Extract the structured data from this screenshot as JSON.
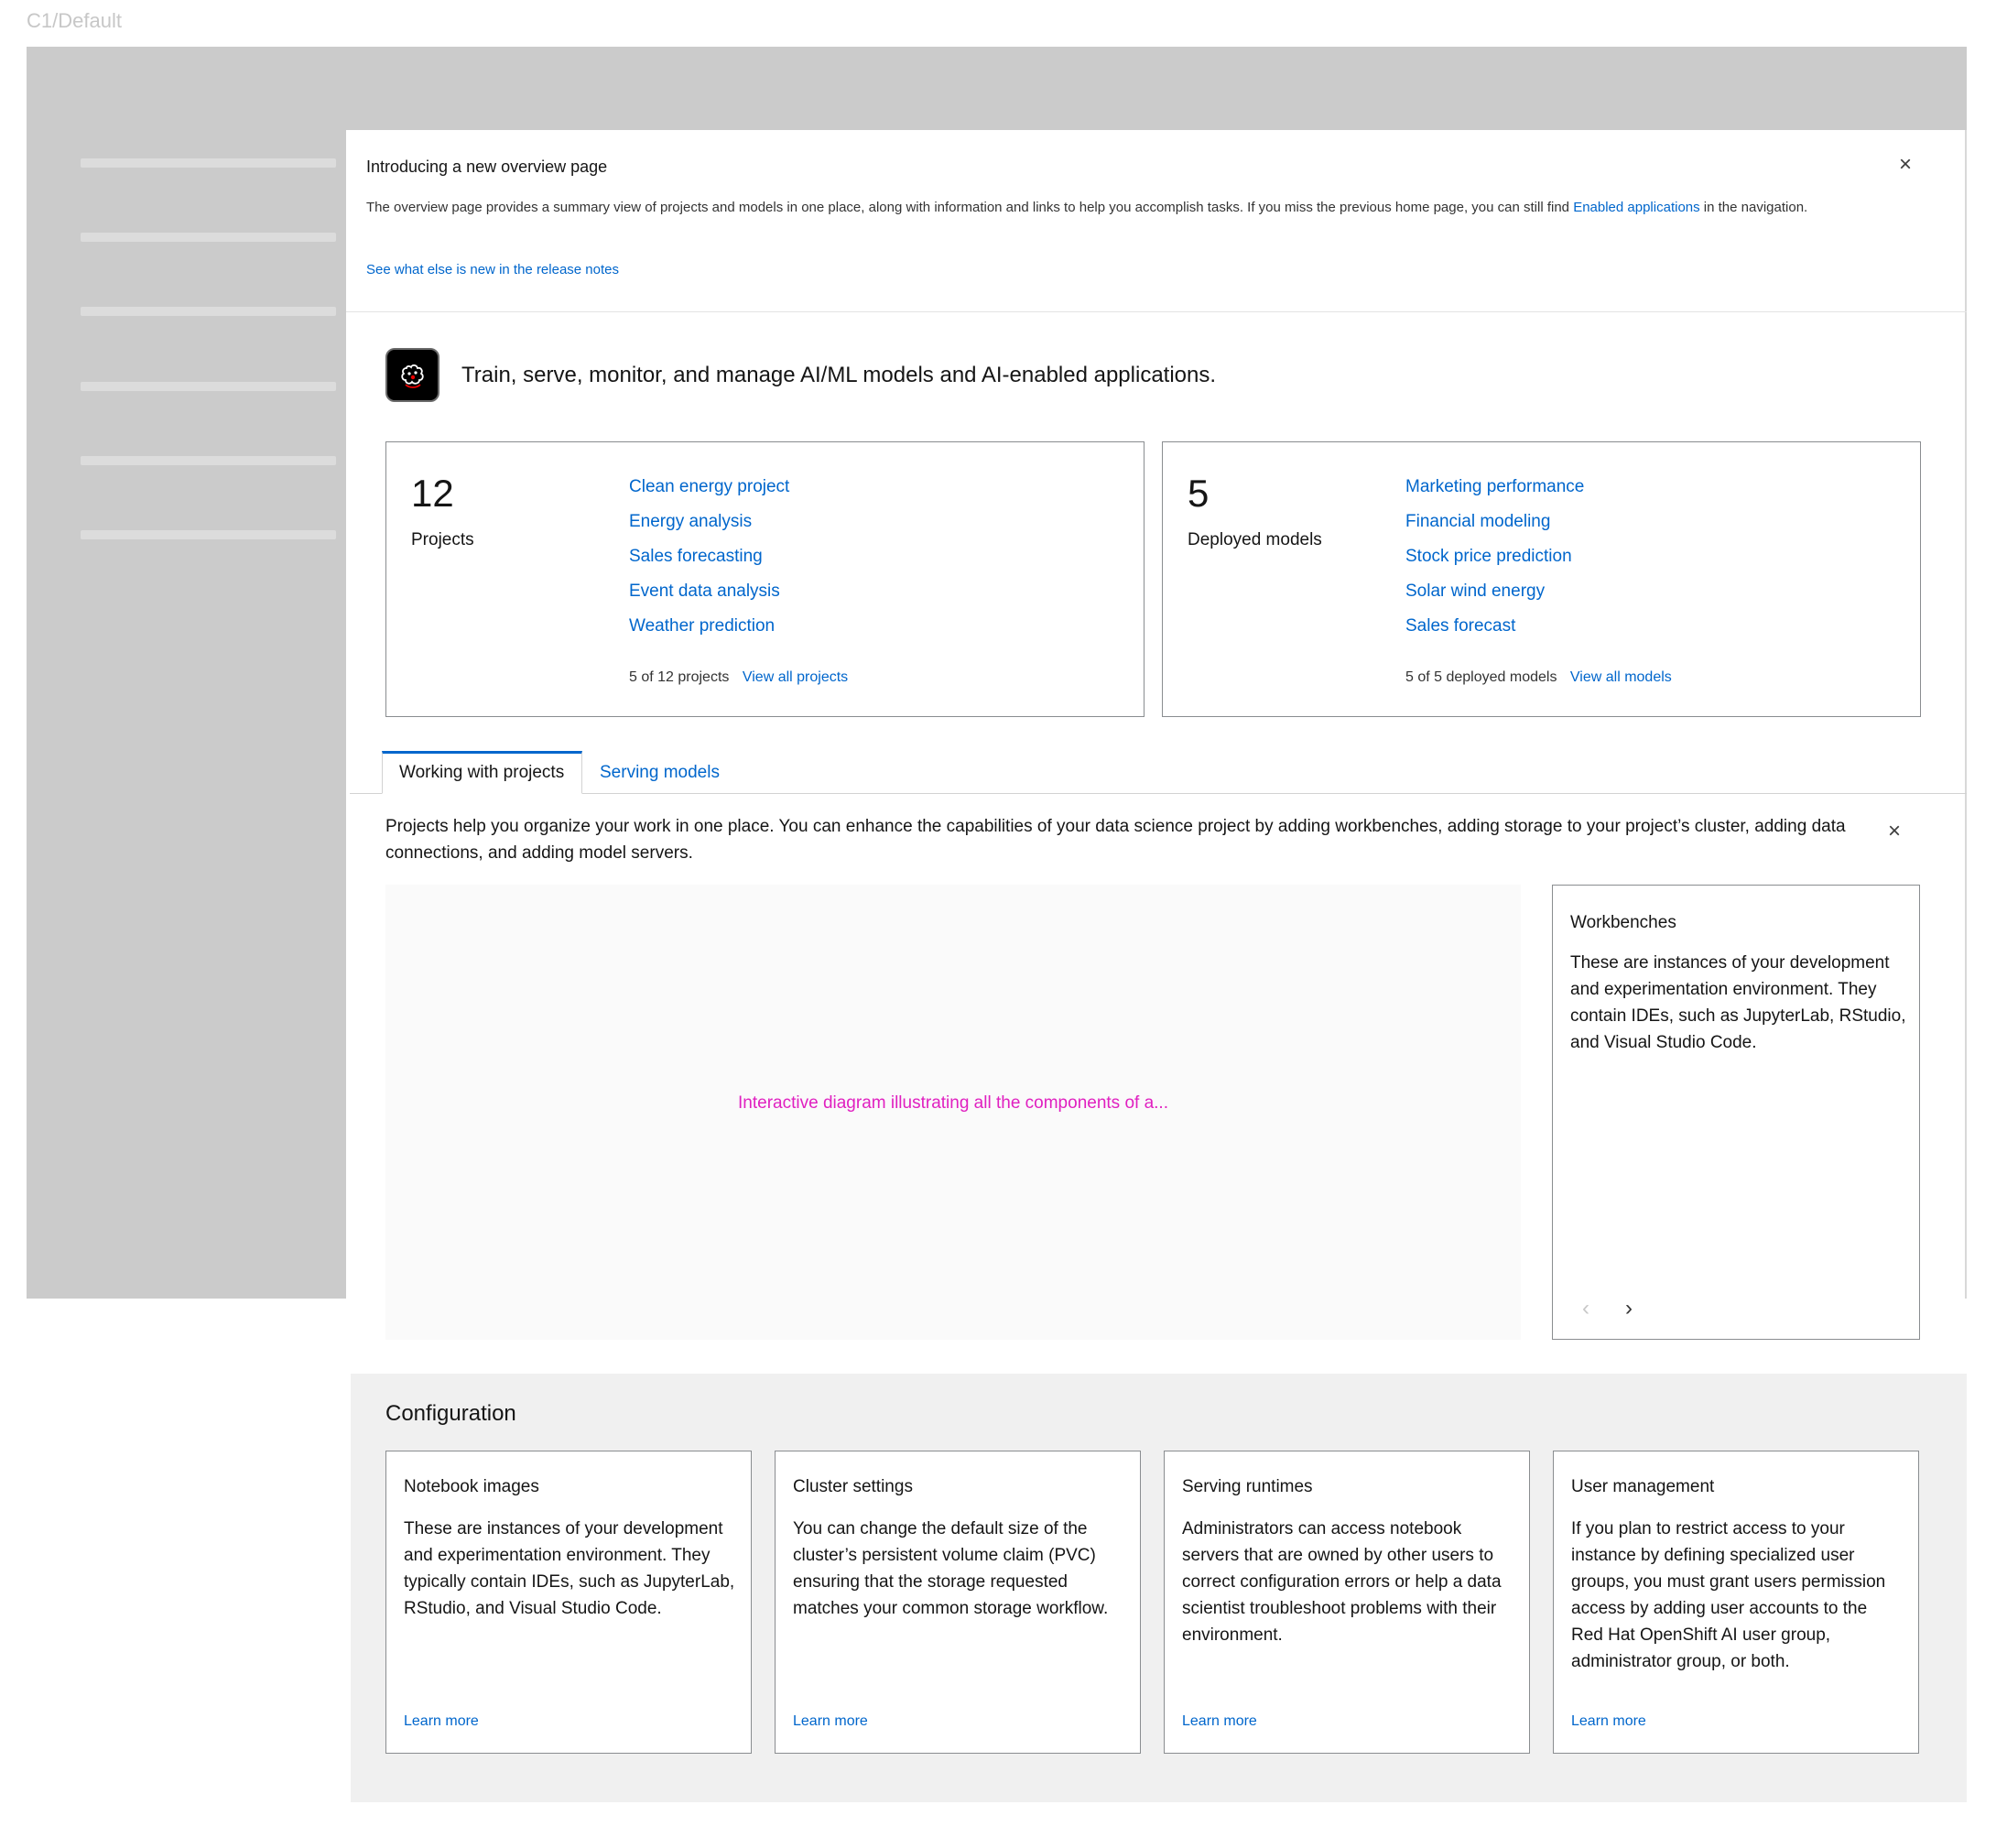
{
  "frame_label": "C1/Default",
  "banner": {
    "title": "Introducing a new overview page",
    "body_prefix": "The overview page provides a summary view of projects and models in one place, along with information and links to help you accomplish tasks. If you miss the previous home page, you can still find",
    "body_link": "Enabled applications",
    "body_suffix": "in the navigation.",
    "release_link": "See what else is new in the release notes",
    "close": "×"
  },
  "headline": "Train, serve, monitor, and manage AI/ML models and AI-enabled applications.",
  "projects": {
    "count": "12",
    "label": "Projects",
    "items": [
      "Clean energy project",
      "Energy analysis",
      "Sales forecasting",
      "Event data analysis",
      "Weather prediction"
    ],
    "footer": "5 of 12 projects",
    "view_all": "View all projects"
  },
  "models": {
    "count": "5",
    "label": "Deployed models",
    "items": [
      "Marketing performance",
      "Financial modeling",
      "Stock price prediction",
      "Solar wind energy",
      "Sales forecast"
    ],
    "footer": "5 of 5 deployed models",
    "view_all": "View all models"
  },
  "tabs": [
    {
      "label": "Working with projects",
      "active": true
    },
    {
      "label": "Serving models",
      "active": false
    }
  ],
  "tab_description": "Projects help you organize your work in one place. You can enhance the capabilities of your data science project by adding workbenches, adding storage to your project’s cluster, adding data connections, and adding model servers.",
  "diagram_text": "Interactive diagram illustrating all the components of a...",
  "side_card": {
    "title": "Workbenches",
    "body": "These are instances of your development and experimentation environment. They contain IDEs, such as JupyterLab, RStudio, and Visual Studio Code."
  },
  "configuration": {
    "title": "Configuration",
    "cards": [
      {
        "title": "Notebook images",
        "body": "These are instances of your development and experimentation environment. They typically contain IDEs, such as JupyterLab, RStudio, and Visual Studio Code.",
        "link": "Learn more"
      },
      {
        "title": "Cluster settings",
        "body": "You can change the default size of the cluster’s persistent volume claim (PVC) ensuring that the storage requested matches your common storage workflow.",
        "link": "Learn more"
      },
      {
        "title": "Serving runtimes",
        "body": "Administrators can access notebook servers that are owned by other users to correct configuration errors or help a data scientist troubleshoot problems with their environment.",
        "link": "Learn more"
      },
      {
        "title": "User management",
        "body": "If you plan to restrict access to your instance by defining specialized user groups, you must grant users permission access by adding user accounts to the Red Hat OpenShift AI user group, administrator group, or both.",
        "link": "Learn more"
      }
    ]
  },
  "icons": {
    "close": "close-icon",
    "prev": "chevron-left-icon",
    "next": "chevron-right-icon",
    "logo": "brain-logo-icon"
  },
  "colors": {
    "link": "#0066cc",
    "diagram_placeholder": "#e020c0",
    "frame_background": "#cbcbcb",
    "config_background": "#f0f0f0"
  }
}
